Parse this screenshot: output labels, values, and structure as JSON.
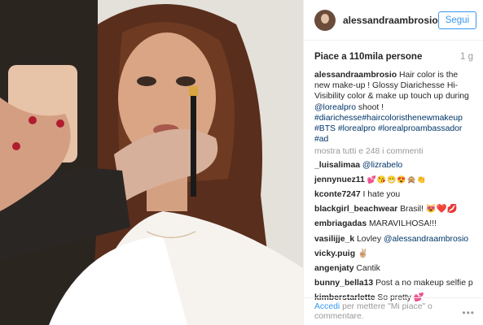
{
  "post": {
    "username": "alessandraambrosio",
    "follow_label": "Segui",
    "likes": "Piace a 110mila persone",
    "time": "1 g"
  },
  "caption": {
    "user": "alessandraambrosio",
    "text1": " Hair color is the new make-up ! Glossy Diarichesse Hi-Visibility color & make up touch up during ",
    "mention": "@lorealpro",
    "text2": " shoot ! ",
    "hashtags": "#diarichesse#haircoloristhenewmakeup #BTS #lorealpro #lorealproambassador #ad"
  },
  "show_all": "mostra tutti e 248 i commenti",
  "comments": [
    {
      "user": "_luisalimaa",
      "text": "",
      "mention": "@lizrabelo"
    },
    {
      "user": "jennynuez11",
      "text": "💕😘😁😍🙊👏",
      "mention": ""
    },
    {
      "user": "kconte7247",
      "text": "I hate you",
      "mention": ""
    },
    {
      "user": "blackgirl_beachwear",
      "text": "Brasil! 😻❤️💋",
      "mention": ""
    },
    {
      "user": "embriagadas",
      "text": "MARAVILHOSA!!!",
      "mention": ""
    },
    {
      "user": "vasilijje_k",
      "text": "Lovley ",
      "mention": "@alessandraambrosio"
    },
    {
      "user": "vicky.puig",
      "text": "✌🏼",
      "mention": ""
    },
    {
      "user": "angenjaty",
      "text": "Cantik",
      "mention": ""
    },
    {
      "user": "bunny_bella13",
      "text": "Post a no makeup selfie pls",
      "mention": ""
    },
    {
      "user": "kimberstarlette",
      "text": "So pretty 💕",
      "mention": ""
    }
  ],
  "footer": {
    "login_link": "Accedi",
    "rest": " per mettere \"Mi piace\" o commentare.",
    "more_icon": "ellipsis-icon"
  }
}
